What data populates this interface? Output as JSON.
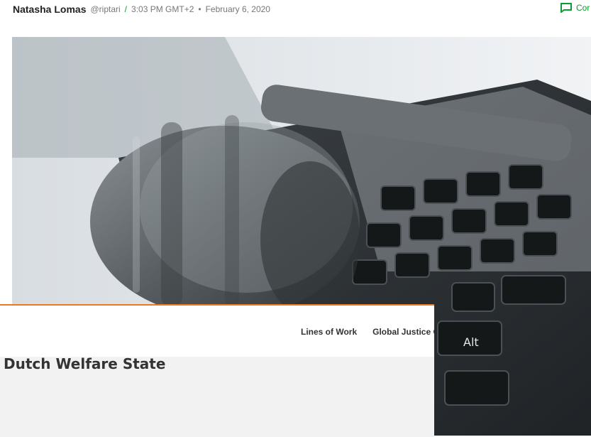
{
  "byline": {
    "author": "Natasha Lomas",
    "handle": "@riptari",
    "separator": "/",
    "time": "3:03 PM GMT+2",
    "bullet": "•",
    "date": "February 6, 2020",
    "comment_label": "Cor"
  },
  "hero": {
    "icon": "gavel-on-keyboard-image",
    "key_label": "Alt"
  },
  "site_nav": {
    "items": [
      "Lines of Work",
      "Global Justice Cli"
    ]
  },
  "page": {
    "title": "Dutch Welfare State"
  },
  "colors": {
    "accent_green": "#0a9d2f",
    "accent_orange": "#e87a26"
  }
}
